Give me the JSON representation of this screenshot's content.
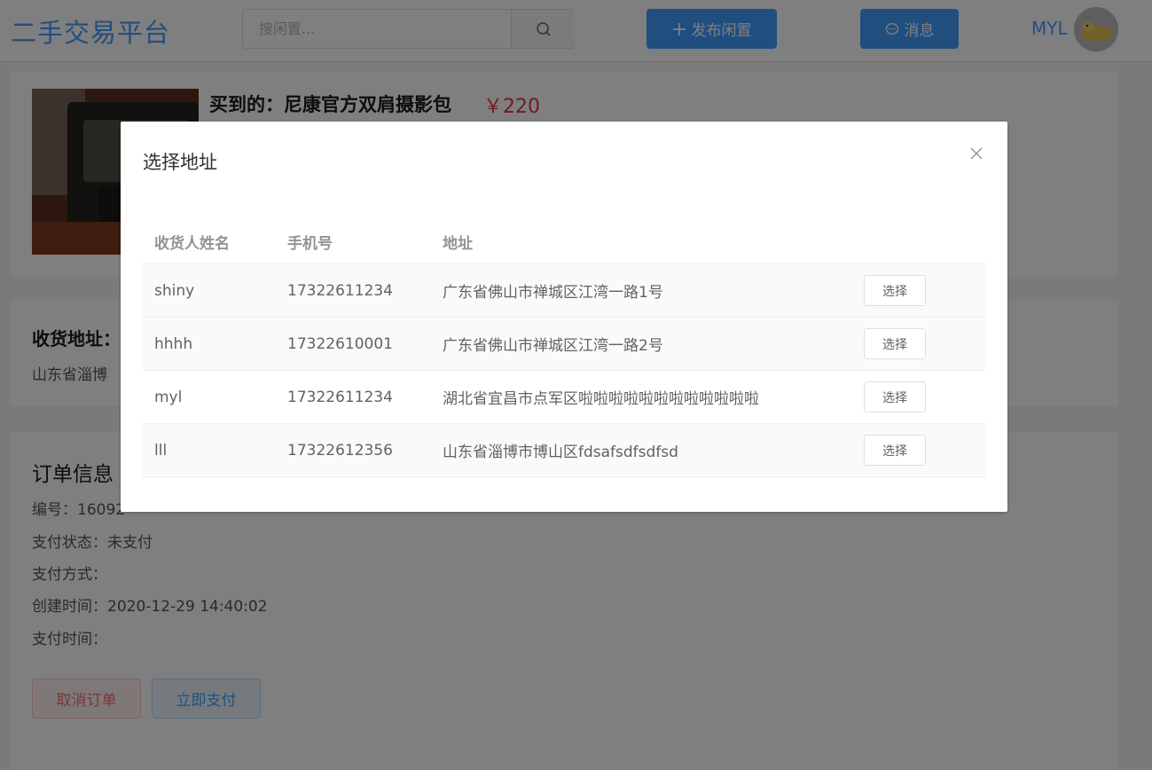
{
  "header": {
    "logo": "二手交易平台",
    "search_placeholder": "搜闲置...",
    "publish_label": "发布闲置",
    "message_label": "消息",
    "username": "MYL"
  },
  "product": {
    "title": "买到的：尼康官方双肩摄影包",
    "price": "￥220"
  },
  "address_section": {
    "heading": "收货地址：",
    "current": "山东省淄博"
  },
  "order": {
    "heading": "订单信息",
    "number_line": "编号：16092",
    "status_line": "支付状态：未支付",
    "method_line": "支付方式：",
    "created_line": "创建时间：2020-12-29 14:40:02",
    "paid_line": "支付时间：",
    "cancel_label": "取消订单",
    "pay_label": "立即支付"
  },
  "dialog": {
    "title": "选择地址",
    "columns": [
      "收货人姓名",
      "手机号",
      "地址"
    ],
    "select_label": "选择",
    "rows": [
      {
        "name": "shiny",
        "phone": "17322611234",
        "address": "广东省佛山市禅城区江湾一路1号"
      },
      {
        "name": "hhhh",
        "phone": "17322610001",
        "address": "广东省佛山市禅城区江湾一路2号"
      },
      {
        "name": "myl",
        "phone": "17322611234",
        "address": "湖北省宜昌市点军区啦啦啦啦啦啦啦啦啦啦啦啦"
      },
      {
        "name": "lll",
        "phone": "17322612356",
        "address": "山东省淄博市博山区fdsafsdfsdfsd"
      }
    ]
  },
  "colors": {
    "primary": "#409eff",
    "price": "#e4393c",
    "danger": "#f56c6c"
  }
}
